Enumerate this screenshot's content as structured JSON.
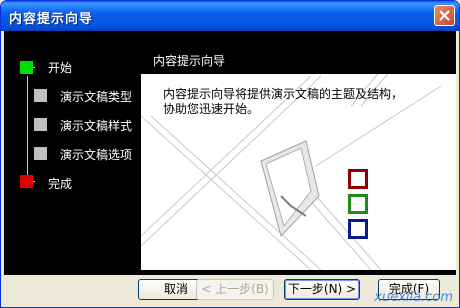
{
  "window": {
    "title": "内容提示向导"
  },
  "steps": [
    {
      "label": "开始",
      "state": "current",
      "color": "#00e000"
    },
    {
      "label": "演示文稿类型",
      "state": "pending",
      "color": "#c0c0c0"
    },
    {
      "label": "演示文稿样式",
      "state": "pending",
      "color": "#c0c0c0"
    },
    {
      "label": "演示文稿选项",
      "state": "pending",
      "color": "#c0c0c0"
    },
    {
      "label": "完成",
      "state": "final",
      "color": "#e00000"
    }
  ],
  "pane": {
    "title": "内容提示向导",
    "description": "内容提示向导将提供演示文稿的主题及结构，协助您迅速开始。"
  },
  "buttons": {
    "cancel": "取消",
    "back": "< 上一步(B)",
    "next": "下一步(N) >",
    "finish": "完成(F)"
  },
  "watermark": "xuexila.com",
  "colors": {
    "square_red": "#8b0000",
    "square_green": "#1e8a1e",
    "square_blue": "#0a1a8c"
  }
}
